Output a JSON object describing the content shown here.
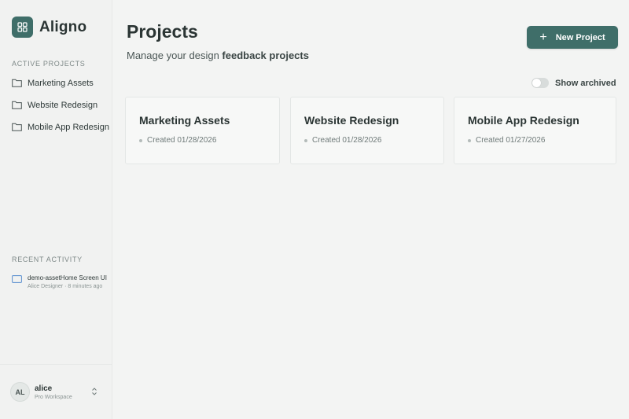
{
  "brand": {
    "name": "Aligno",
    "logo_icon": "grid-icon",
    "accent": "#3f6e69"
  },
  "sidebar": {
    "active_label": "ACTIVE PROJECTS",
    "projects": [
      {
        "label": "Marketing Assets",
        "icon": "folder-icon"
      },
      {
        "label": "Website Redesign",
        "icon": "folder-icon"
      },
      {
        "label": "Mobile App Redesign",
        "icon": "folder-icon"
      }
    ],
    "recent_label": "RECENT ACTIVITY",
    "activity": [
      {
        "title": "demo-assetHome Screen UI",
        "subtitle": "Alice Designer · 8 minutes ago",
        "icon": "screen-icon"
      }
    ],
    "user": {
      "initials": "AL",
      "name": "alice",
      "plan": "Pro Workspace"
    }
  },
  "main": {
    "title": "Projects",
    "subtitle_prefix": "Manage your design ",
    "subtitle_emphasis": "feedback projects",
    "new_button_label": "New Project",
    "show_archived_label": "Show archived",
    "show_archived": false,
    "cards": [
      {
        "title": "Marketing Assets",
        "created": "Created 01/28/2026"
      },
      {
        "title": "Website Redesign",
        "created": "Created 01/28/2026"
      },
      {
        "title": "Mobile App Redesign",
        "created": "Created 01/27/2026"
      }
    ]
  }
}
